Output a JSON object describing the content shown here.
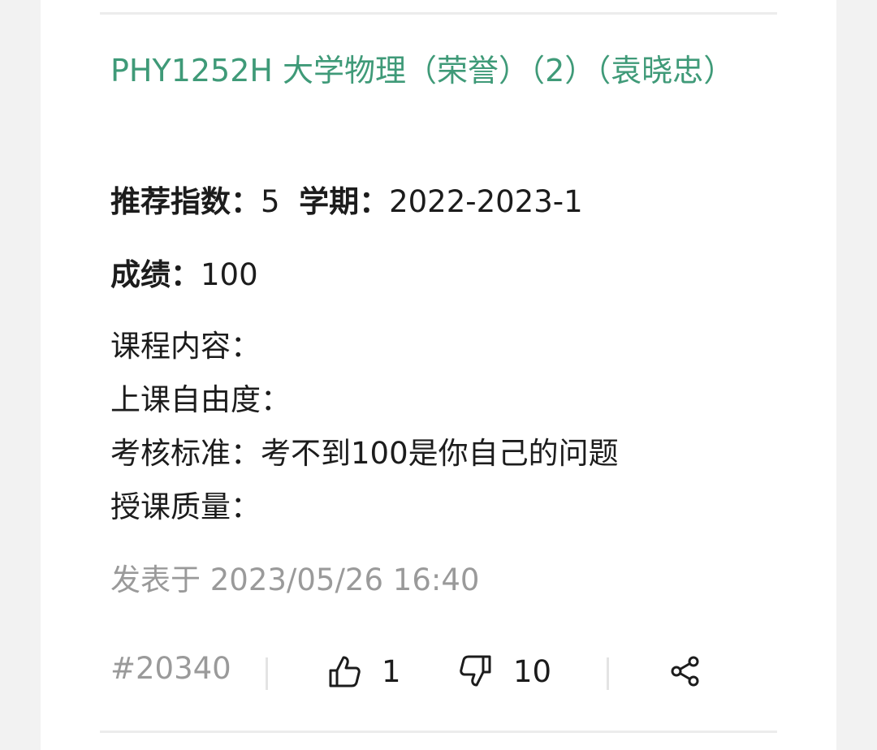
{
  "post": {
    "title": "PHY1252H 大学物理（荣誉）（2）（袁晓忠）",
    "recommend_label": "推荐指数：",
    "recommend_value": "5",
    "term_label": "学期：",
    "term_value": "2022-2023-1",
    "grade_label": "成绩：",
    "grade_value": "100",
    "review_text": "课程内容：\n上课自由度：\n考核标准：考不到100是你自己的问题\n授课质量：",
    "posted_label": "发表于 2023/05/26 16:40",
    "id": "#20340"
  },
  "actions": {
    "like": {
      "icon": "thumbs-up-icon",
      "count": "1"
    },
    "dislike": {
      "icon": "thumbs-down-icon",
      "count": "10"
    },
    "share": {
      "icon": "share-icon"
    }
  },
  "colors": {
    "title": "#3f9a78",
    "meta": "#9a9a9a",
    "text": "#1c1c1c"
  }
}
